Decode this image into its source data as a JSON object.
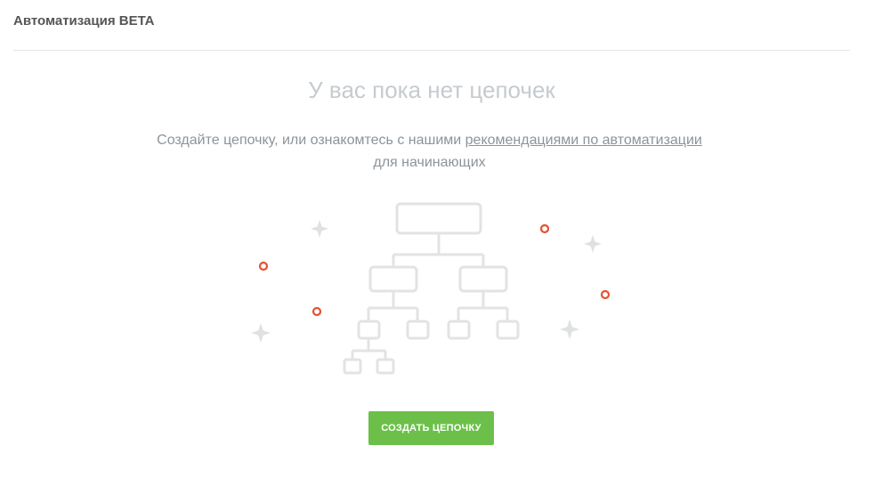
{
  "header": {
    "title": "Автоматизация BETA"
  },
  "empty_state": {
    "title": "У вас пока нет цепочек",
    "description_before": "Создайте цепочку, или ознакомтесь с нашими ",
    "link_text": "рекомендациями по автоматизации",
    "description_after": "для начинающих",
    "button_label": "СОЗДАТЬ ЦЕПОЧКУ"
  },
  "colors": {
    "accent_green": "#6cc04a",
    "dot_orange": "#e5532f",
    "sparkle_gray": "#dfe1e3",
    "tree_gray": "#e3e3e3"
  },
  "illustration": {
    "tree_icon": "hierarchy-tree-icon",
    "sparkle_icon": "sparkle-icon",
    "dot_icon": "circle-dot-icon"
  }
}
